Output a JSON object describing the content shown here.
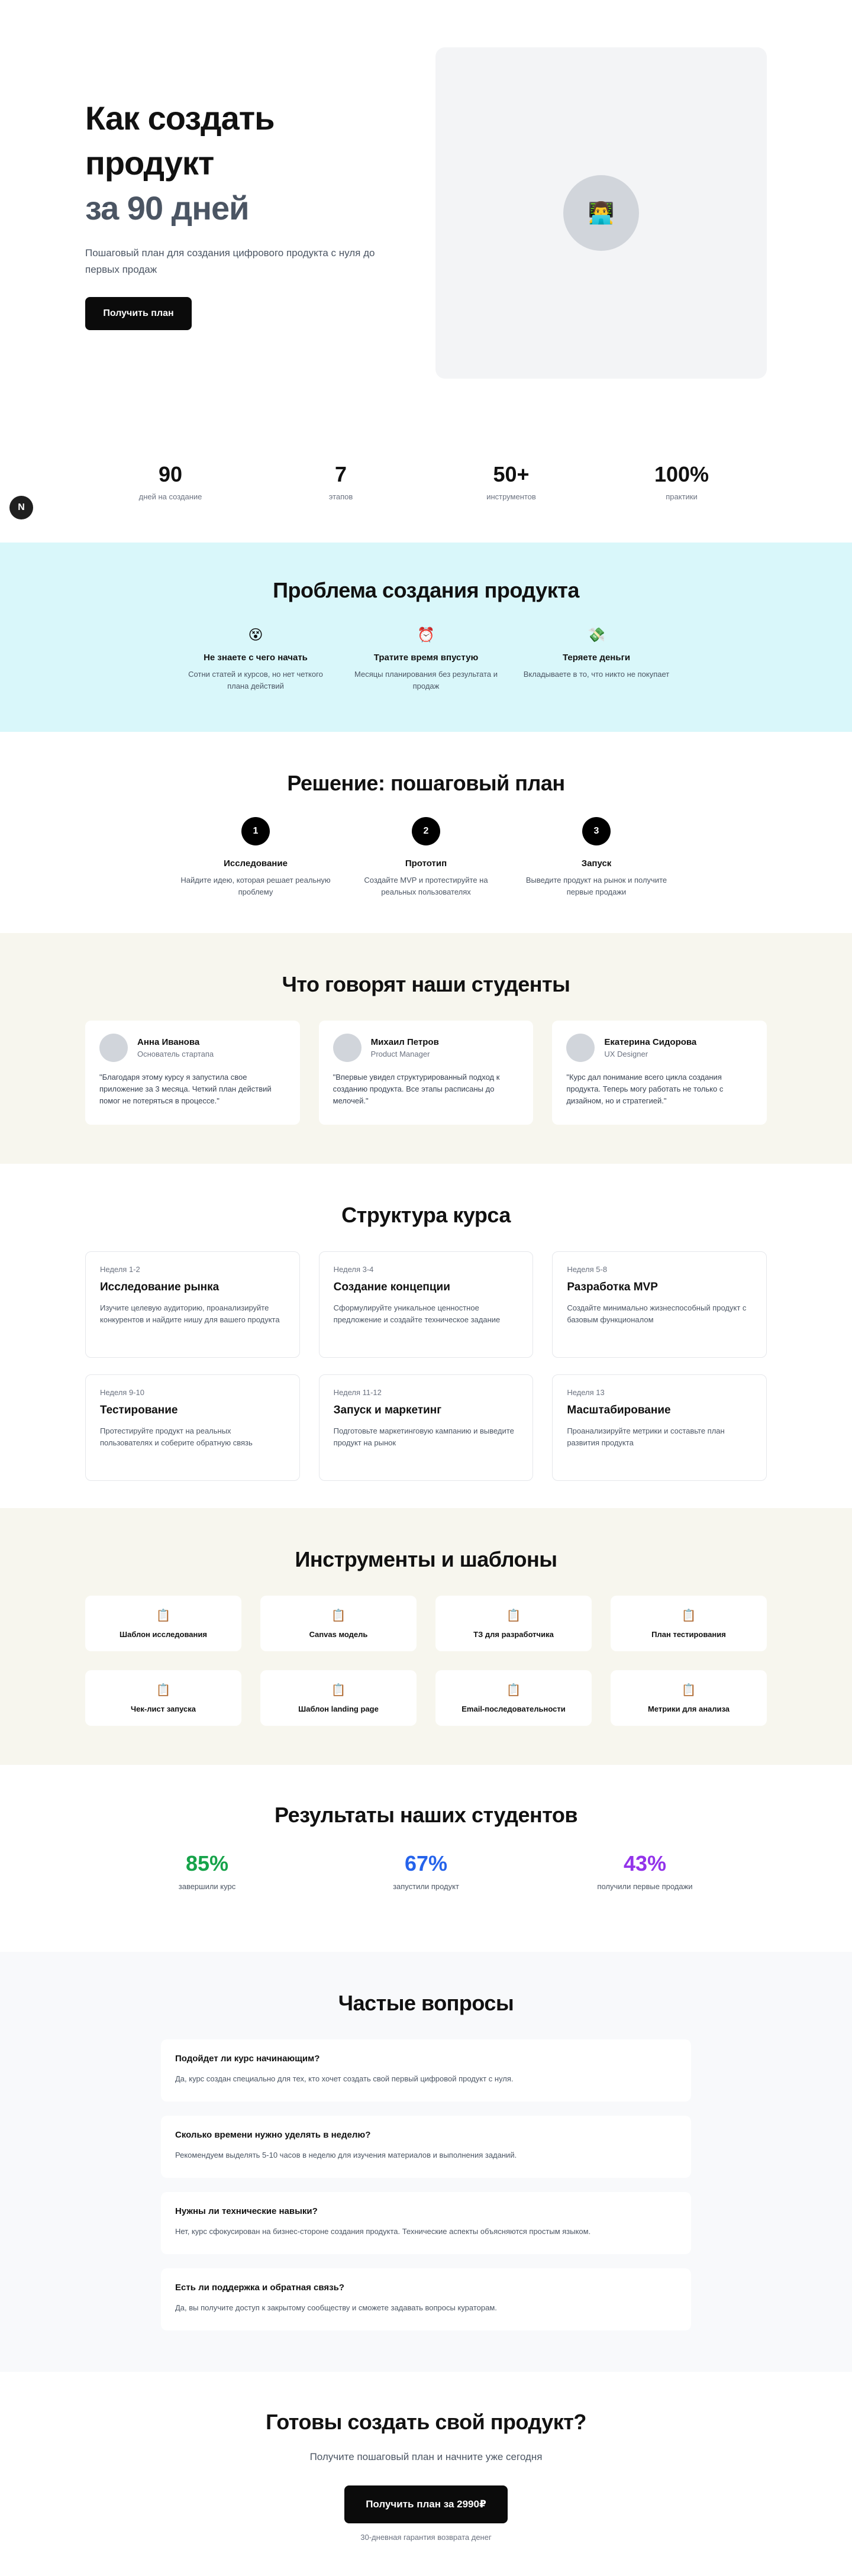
{
  "hero": {
    "title_line1": "Как создать",
    "title_line2": "продукт",
    "title_accent": "за 90 дней",
    "subtitle": "Пошаговый план для создания цифрового продукта с нуля до первых продаж",
    "cta_label": "Получить план",
    "image_icon": "👨‍💻"
  },
  "badge": {
    "letter": "N"
  },
  "stats": [
    {
      "value": "90",
      "label": "дней на создание"
    },
    {
      "value": "7",
      "label": "этапов"
    },
    {
      "value": "50+",
      "label": "инструментов"
    },
    {
      "value": "100%",
      "label": "практики"
    }
  ],
  "problem": {
    "title": "Проблема создания продукта",
    "items": [
      {
        "icon": "😵",
        "title": "Не знаете с чего начать",
        "text": "Сотни статей и курсов, но нет четкого плана действий"
      },
      {
        "icon": "⏰",
        "title": "Тратите время впустую",
        "text": "Месяцы планирования без результата и продаж"
      },
      {
        "icon": "💸",
        "title": "Теряете деньги",
        "text": "Вкладываете в то, что никто не покупает"
      }
    ]
  },
  "solution": {
    "title": "Решение: пошаговый план",
    "steps": [
      {
        "num": "1",
        "title": "Исследование",
        "text": "Найдите идею, которая решает реальную проблему"
      },
      {
        "num": "2",
        "title": "Прототип",
        "text": "Создайте MVP и протестируйте на реальных пользователях"
      },
      {
        "num": "3",
        "title": "Запуск",
        "text": "Выведите продукт на рынок и получите первые продажи"
      }
    ]
  },
  "testimonials": {
    "title": "Что говорят наши студенты",
    "items": [
      {
        "name": "Анна Иванова",
        "role": "Основатель стартапа",
        "text": "\"Благодаря этому курсу я запустила свое приложение за 3 месяца. Четкий план действий помог не потеряться в процессе.\""
      },
      {
        "name": "Михаил Петров",
        "role": "Product Manager",
        "text": "\"Впервые увидел структурированный подход к созданию продукта. Все этапы расписаны до мелочей.\""
      },
      {
        "name": "Екатерина Сидорова",
        "role": "UX Designer",
        "text": "\"Курс дал понимание всего цикла создания продукта. Теперь могу работать не только с дизайном, но и стратегией.\""
      }
    ]
  },
  "structure": {
    "title": "Структура курса",
    "items": [
      {
        "week": "Неделя 1-2",
        "title": "Исследование рынка",
        "text": "Изучите целевую аудиторию, проанализируйте конкурентов и найдите нишу для вашего продукта"
      },
      {
        "week": "Неделя 3-4",
        "title": "Создание концепции",
        "text": "Сформулируйте уникальное ценностное предложение и создайте техническое задание"
      },
      {
        "week": "Неделя 5-8",
        "title": "Разработка MVP",
        "text": "Создайте минимально жизнеспособный продукт с базовым функционалом"
      },
      {
        "week": "Неделя 9-10",
        "title": "Тестирование",
        "text": "Протестируйте продукт на реальных пользователях и соберите обратную связь"
      },
      {
        "week": "Неделя 11-12",
        "title": "Запуск и маркетинг",
        "text": "Подготовьте маркетинговую кампанию и выведите продукт на рынок"
      },
      {
        "week": "Неделя 13",
        "title": "Масштабирование",
        "text": "Проанализируйте метрики и составьте план развития продукта"
      }
    ]
  },
  "tools": {
    "title": "Инструменты и шаблоны",
    "icon": "📋",
    "items": [
      "Шаблон исследования",
      "Canvas модель",
      "ТЗ для разработчика",
      "План тестирования",
      "Чек-лист запуска",
      "Шаблон landing page",
      "Email-последовательности",
      "Метрики для анализа"
    ]
  },
  "results": {
    "title": "Результаты наших студентов",
    "items": [
      {
        "value": "85%",
        "label": "завершили курс",
        "color": "#16a34a"
      },
      {
        "value": "67%",
        "label": "запустили продукт",
        "color": "#2563eb"
      },
      {
        "value": "43%",
        "label": "получили первые продажи",
        "color": "#9333ea"
      }
    ]
  },
  "faq": {
    "title": "Частые вопросы",
    "items": [
      {
        "q": "Подойдет ли курс начинающим?",
        "a": "Да, курс создан специально для тех, кто хочет создать свой первый цифровой продукт с нуля."
      },
      {
        "q": "Сколько времени нужно уделять в неделю?",
        "a": "Рекомендуем выделять 5-10 часов в неделю для изучения материалов и выполнения заданий."
      },
      {
        "q": "Нужны ли технические навыки?",
        "a": "Нет, курс сфокусирован на бизнес-стороне создания продукта. Технические аспекты объясняются простым языком."
      },
      {
        "q": "Есть ли поддержка и обратная связь?",
        "a": "Да, вы получите доступ к закрытому сообществу и сможете задавать вопросы кураторам."
      }
    ]
  },
  "cta": {
    "title": "Готовы создать свой продукт?",
    "subtitle": "Получите пошаговый план и начните уже сегодня",
    "button": "Получить план за 2990₽",
    "note": "30-дневная гарантия возврата денег"
  }
}
